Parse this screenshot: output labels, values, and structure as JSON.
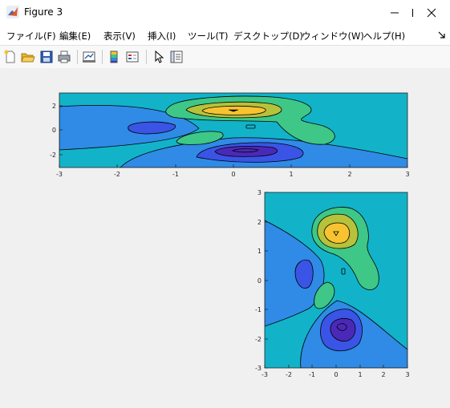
{
  "window": {
    "title": "Figure 3"
  },
  "menu": [
    "ファイル(F)",
    "編集(E)",
    "表示(V)",
    "挿入(I)",
    "ツール(T)",
    "デスクトップ(D)",
    "ウィンドウ(W)",
    "ヘルプ(H)"
  ],
  "toolbar_icons": [
    "new-figure-icon",
    "open-file-icon",
    "save-icon",
    "print-icon",
    "link-plot-icon",
    "colorbar-icon",
    "legend-icon",
    "pointer-icon",
    "property-inspector-icon"
  ],
  "colors": {
    "level1": "#4a29b8",
    "level2": "#3a54e6",
    "level3": "#2f8be6",
    "level4": "#12b3c9",
    "level5": "#3ec786",
    "level6": "#b6c23a",
    "level7": "#f8c331"
  },
  "plot1": {
    "xticks": [
      "-3",
      "-2",
      "-1",
      "0",
      "1",
      "2",
      "3"
    ],
    "yticks": [
      "2",
      "0",
      "-2"
    ]
  },
  "plot2": {
    "xticks": [
      "-3",
      "-2",
      "-1",
      "0",
      "1",
      "2",
      "3"
    ],
    "yticks": [
      "3",
      "2",
      "1",
      "0",
      "-1",
      "-2",
      "-3"
    ]
  }
}
